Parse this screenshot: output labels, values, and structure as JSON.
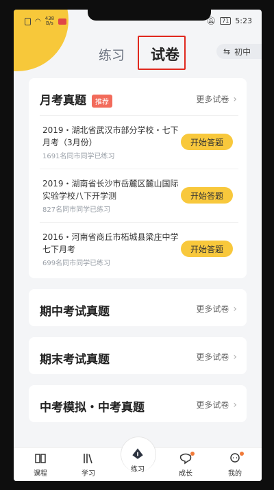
{
  "status_bar": {
    "speed": "438",
    "speed_unit": "B/s",
    "battery": "71",
    "time": "5:23"
  },
  "tabs": {
    "practice": "练习",
    "papers": "试卷"
  },
  "grade": {
    "label": "初中"
  },
  "monthly": {
    "title": "月考真题",
    "badge": "推荐",
    "more": "更多试卷",
    "papers": [
      {
        "title": "2019・湖北省武汉市部分学校・七下月考（3月份）",
        "count": "1691名同市同学已练习",
        "button": "开始答题"
      },
      {
        "title": "2019・湖南省长沙市岳麓区麓山国际实验学校八下开学测",
        "count": "827名同市同学已练习",
        "button": "开始答题"
      },
      {
        "title": "2016・河南省商丘市柘城县梁庄中学七下月考",
        "count": "699名同市同学已练习",
        "button": "开始答题"
      }
    ]
  },
  "sections": [
    {
      "title": "期中考试真题",
      "more": "更多试卷"
    },
    {
      "title": "期末考试真题",
      "more": "更多试卷"
    },
    {
      "title": "中考模拟・中考真题",
      "more": "更多试卷"
    }
  ],
  "bottom_nav": {
    "course": "课程",
    "study": "学习",
    "practice": "练习",
    "growth": "成长",
    "mine": "我的"
  },
  "colors": {
    "accent": "#f7c83a",
    "badge": "#f26b5b",
    "highlight": "#e0281e"
  }
}
